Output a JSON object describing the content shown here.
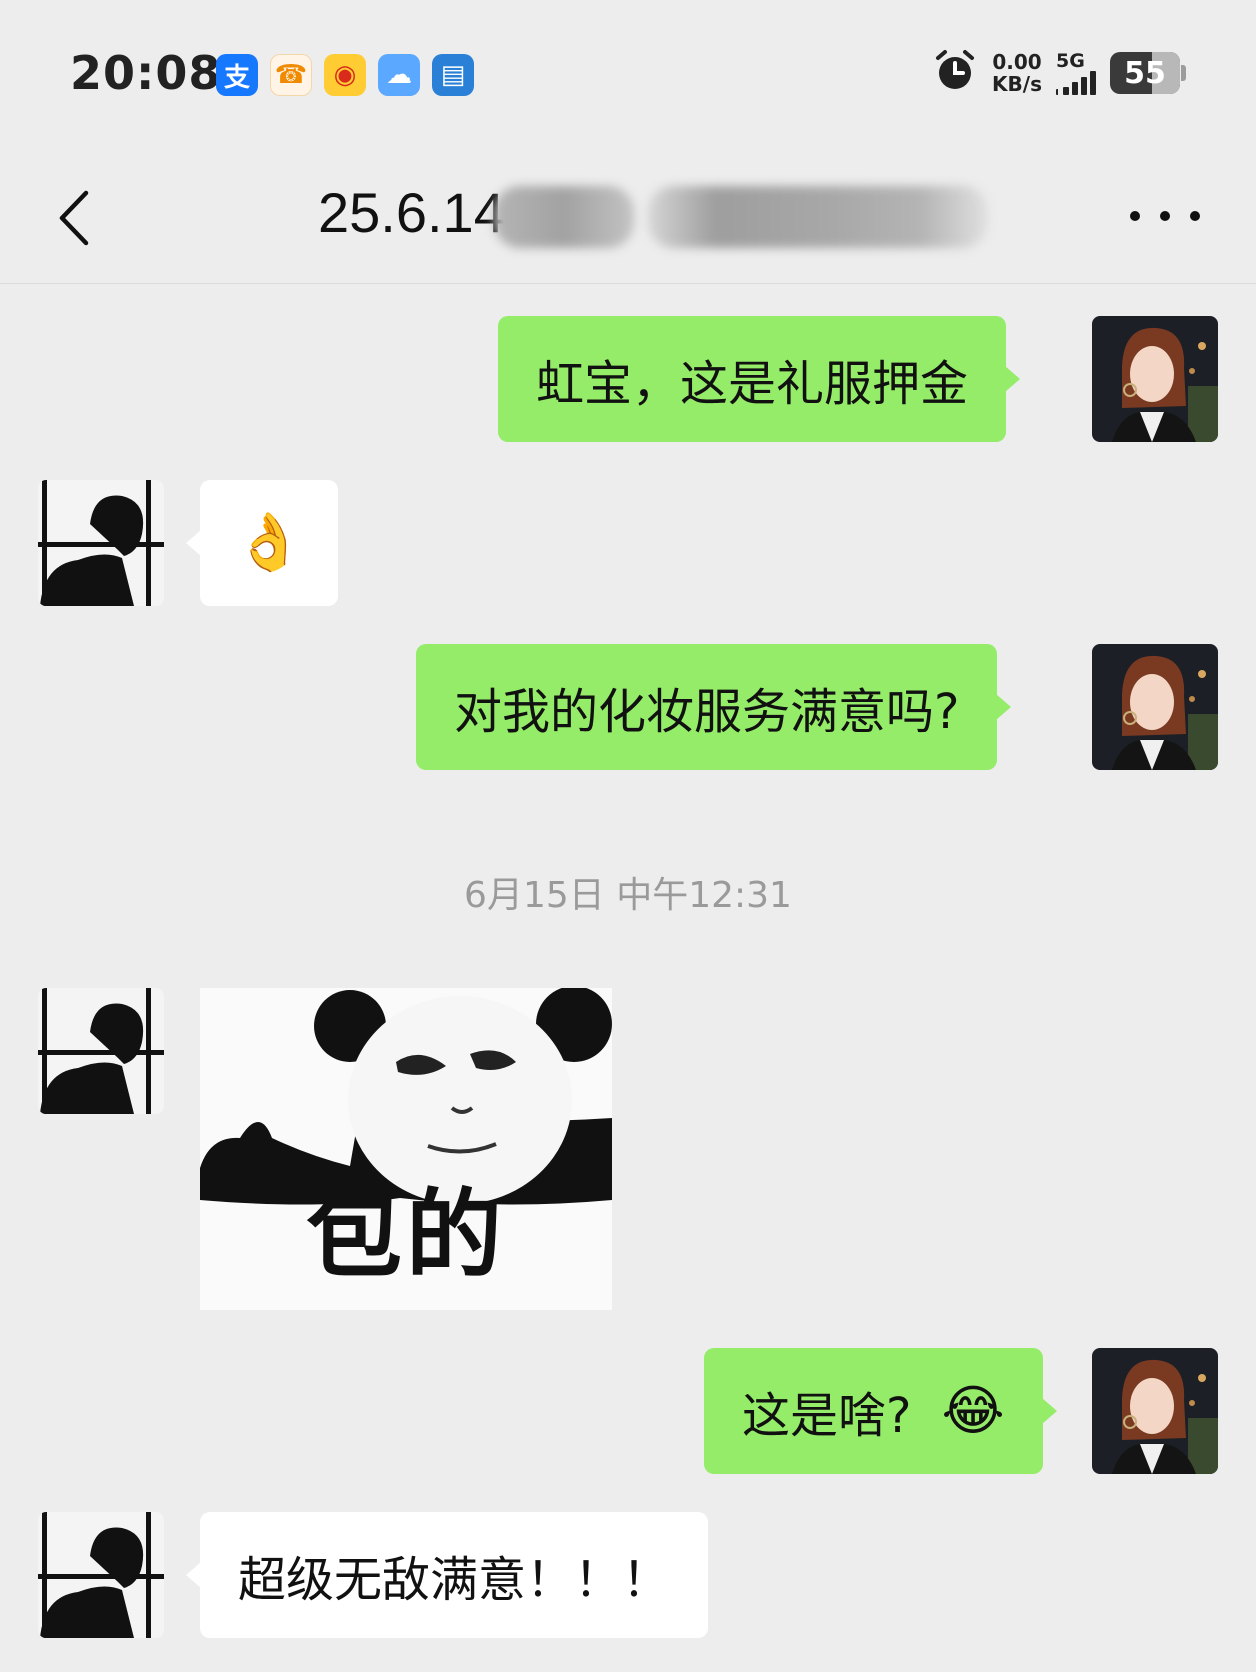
{
  "status_bar": {
    "time": "20:08",
    "notification_icons": [
      {
        "name": "alipay-icon",
        "glyph": "支"
      },
      {
        "name": "xiaotiancai-icon",
        "glyph": "☎"
      },
      {
        "name": "weibo-icon",
        "glyph": "◉"
      },
      {
        "name": "weather-icon",
        "glyph": "☁"
      },
      {
        "name": "philips-app-icon",
        "glyph": "▤"
      }
    ],
    "net_speed_value": "0.00",
    "net_speed_unit": "KB/s",
    "network_type": "5G",
    "battery_level": "55"
  },
  "nav": {
    "title": "25.6.14"
  },
  "messages": [
    {
      "side": "right",
      "text": "虹宝，这是礼服押金"
    },
    {
      "side": "left",
      "emoji": "👌"
    },
    {
      "side": "right",
      "text": "对我的化妆服务满意吗?"
    },
    {
      "timestamp": "6月15日 中午12:31"
    },
    {
      "side": "left",
      "sticker_text": "包的"
    },
    {
      "side": "right",
      "text": "这是啥?",
      "emoji": "😂"
    },
    {
      "side": "left",
      "text": "超级无敌满意！！！"
    }
  ],
  "colors": {
    "background": "#ededed",
    "sent_bubble": "#95ec69",
    "received_bubble": "#ffffff"
  }
}
